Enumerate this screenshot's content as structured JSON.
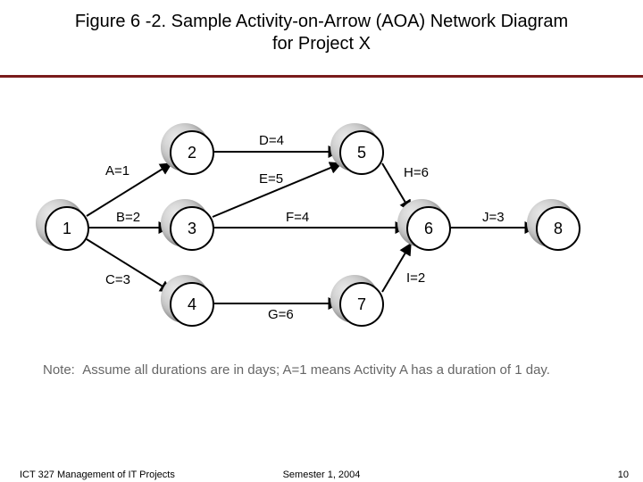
{
  "title_line1": "Figure 6 -2. Sample Activity-on-Arrow (AOA) Network Diagram",
  "title_line2": "for Project X",
  "nodes": {
    "n1": "1",
    "n2": "2",
    "n3": "3",
    "n4": "4",
    "n5": "5",
    "n6": "6",
    "n7": "7",
    "n8": "8"
  },
  "arcs": {
    "A": "A=1",
    "B": "B=2",
    "C": "C=3",
    "D": "D=4",
    "E": "E=5",
    "F": "F=4",
    "G": "G=6",
    "H": "H=6",
    "I": "I=2",
    "J": "J=3"
  },
  "note_label": "Note:",
  "note_text": "Assume all durations are in days;  A=1 means Activity A has a duration of 1 day.",
  "footer_left": "ICT 327 Management of IT Projects",
  "footer_center": "Semester 1, 2004",
  "footer_right": "10",
  "chart_data": {
    "type": "network-AOA",
    "nodes": [
      1,
      2,
      3,
      4,
      5,
      6,
      7,
      8
    ],
    "activities": [
      {
        "name": "A",
        "from": 1,
        "to": 2,
        "duration": 1
      },
      {
        "name": "B",
        "from": 1,
        "to": 3,
        "duration": 2
      },
      {
        "name": "C",
        "from": 1,
        "to": 4,
        "duration": 3
      },
      {
        "name": "D",
        "from": 2,
        "to": 5,
        "duration": 4
      },
      {
        "name": "E",
        "from": 3,
        "to": 5,
        "duration": 5
      },
      {
        "name": "F",
        "from": 3,
        "to": 6,
        "duration": 4
      },
      {
        "name": "G",
        "from": 4,
        "to": 7,
        "duration": 6
      },
      {
        "name": "H",
        "from": 5,
        "to": 6,
        "duration": 6
      },
      {
        "name": "I",
        "from": 7,
        "to": 6,
        "duration": 2
      },
      {
        "name": "J",
        "from": 6,
        "to": 8,
        "duration": 3
      }
    ],
    "duration_unit": "days"
  }
}
